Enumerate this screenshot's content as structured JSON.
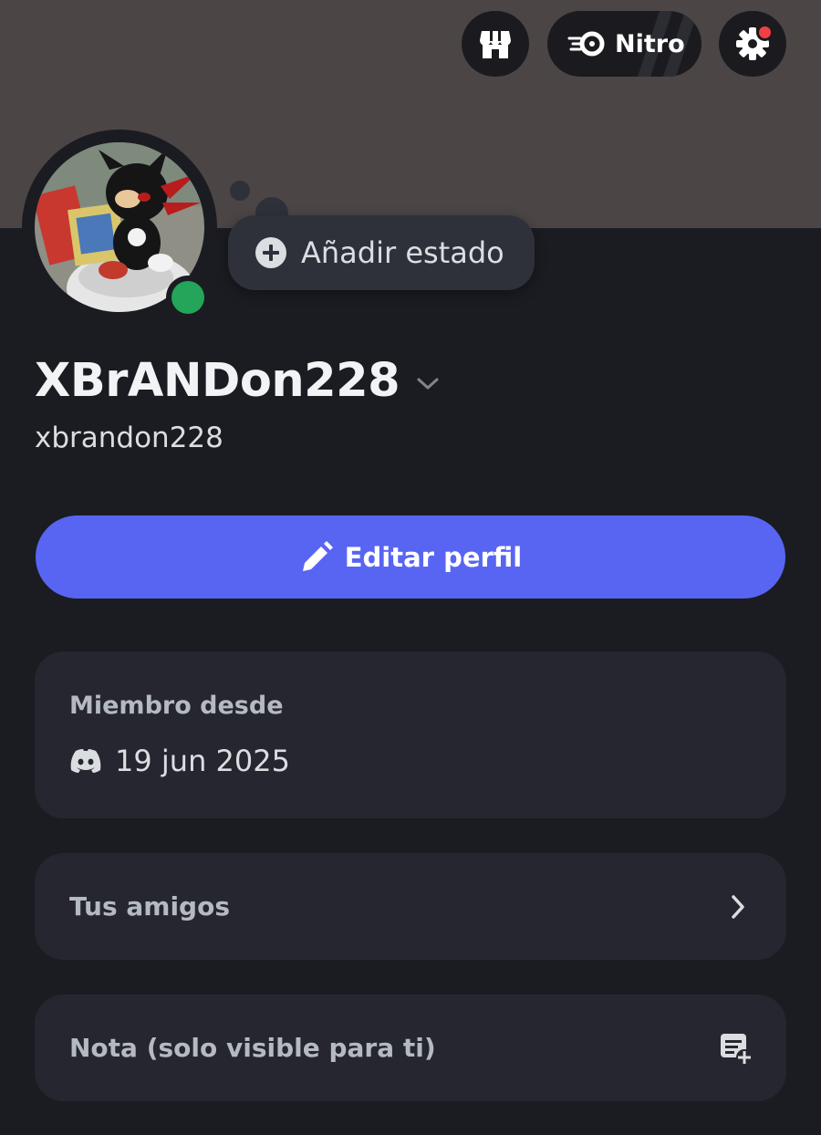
{
  "header": {
    "shop_icon": "shop-icon",
    "nitro_label": "Nitro",
    "nitro_icon": "nitro-icon",
    "settings_icon": "gear-icon",
    "settings_notification": true
  },
  "profile": {
    "avatar_description": "avatar-image",
    "presence": "online",
    "status_button_label": "Añadir estado",
    "display_name": "XBrANDon228",
    "username": "xbrandon228"
  },
  "actions": {
    "edit_profile_label": "Editar perfil"
  },
  "member_since": {
    "title": "Miembro desde",
    "date": "19 jun 2025",
    "icon": "discord-icon"
  },
  "friends": {
    "label": "Tus amigos",
    "icon": "chevron-right-icon"
  },
  "note": {
    "label": "Nota (solo visible para ti)",
    "icon": "note-add-icon"
  },
  "colors": {
    "banner": "#4c4546",
    "background": "#1b1c22",
    "accent": "#5865f2",
    "online": "#23a55a",
    "notification": "#f23f43"
  }
}
